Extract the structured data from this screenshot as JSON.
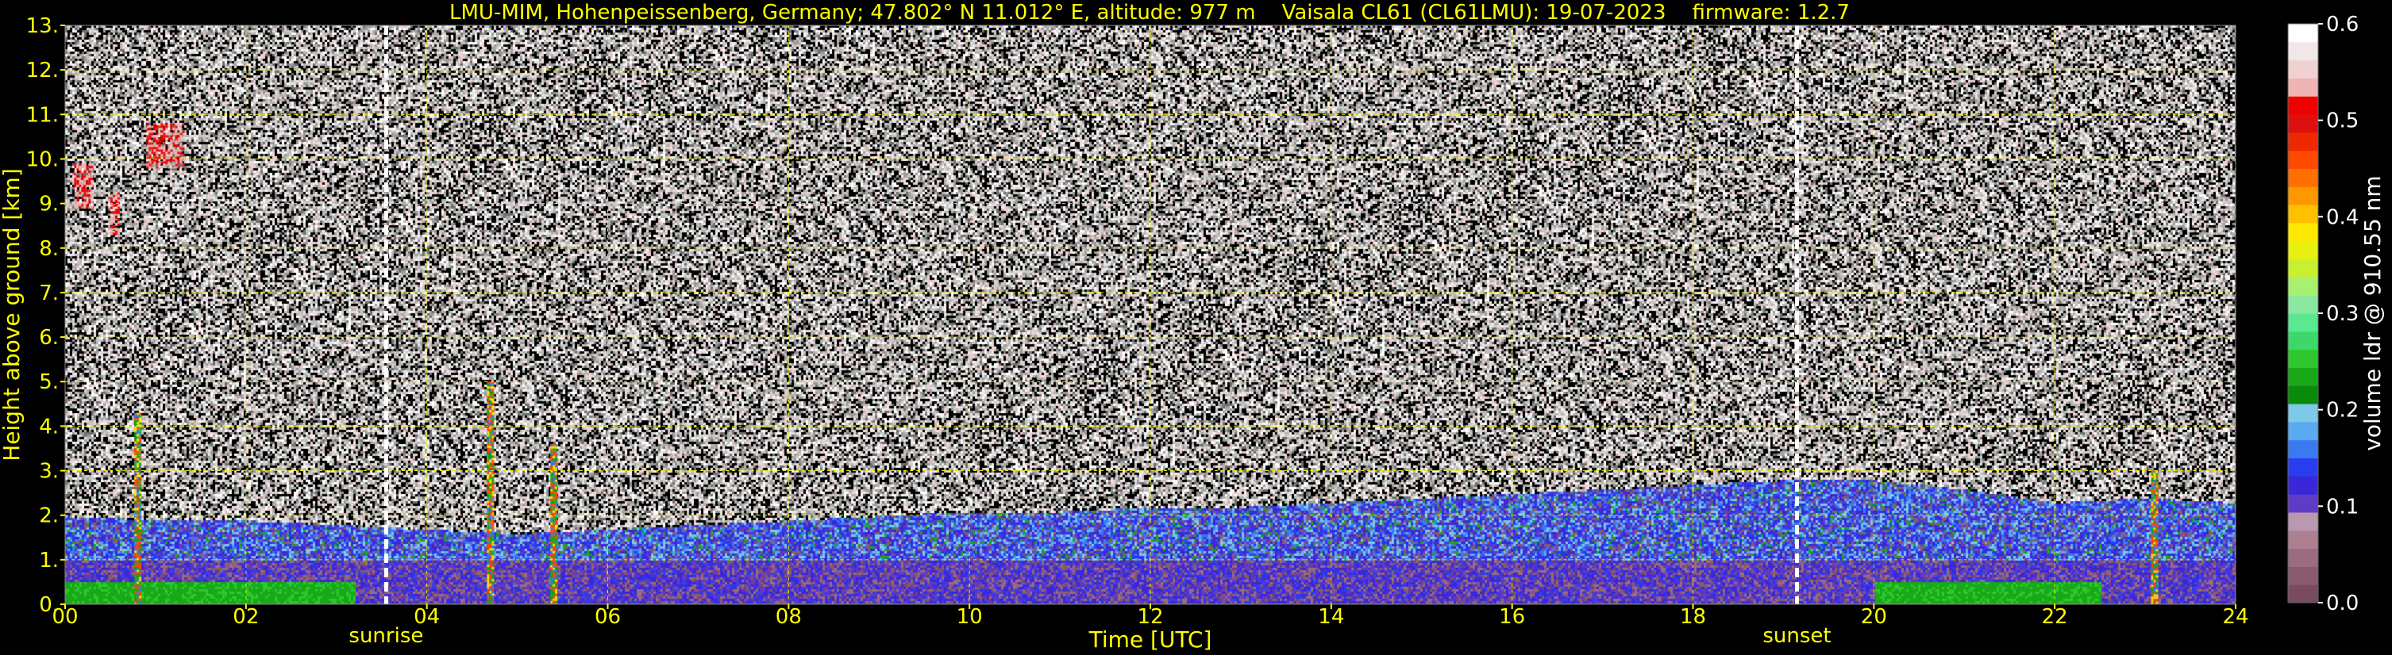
{
  "chart_data": {
    "type": "heatmap",
    "title": "LMU-MIM, Hohenpeissenberg, Germany; 47.802° N 11.012° E, altitude: 977 m    Vaisala CL61 (CL61LMU): 19-07-2023    firmware: 1.2.7",
    "xlabel": "Time [UTC]",
    "ylabel": "Height above ground [km]",
    "xlim": [
      0,
      24
    ],
    "ylim": [
      0,
      13
    ],
    "x_ticks": [
      0,
      2,
      4,
      6,
      8,
      10,
      12,
      14,
      16,
      18,
      20,
      22,
      24
    ],
    "x_tick_labels": [
      "00",
      "02",
      "04",
      "06",
      "08",
      "10",
      "12",
      "14",
      "16",
      "18",
      "20",
      "22",
      "24"
    ],
    "y_ticks": [
      0,
      1,
      2,
      3,
      4,
      5,
      6,
      7,
      8,
      9,
      10,
      11,
      12,
      13
    ],
    "y_tick_labels": [
      "0.",
      "1.",
      "2.",
      "3.",
      "4.",
      "5.",
      "6.",
      "7.",
      "8.",
      "9.",
      "10.",
      "11.",
      "12.",
      "13."
    ],
    "grid": true,
    "events": [
      {
        "label": "sunrise",
        "time": 3.55
      },
      {
        "label": "sunset",
        "time": 19.15
      }
    ],
    "colorbar": {
      "label": "volume ldr @ 910.55 nm",
      "range": [
        0.0,
        0.6
      ],
      "ticks": [
        0.0,
        0.1,
        0.2,
        0.3,
        0.4,
        0.5,
        0.6
      ],
      "tick_labels": [
        "0.0",
        "0.1",
        "0.2",
        "0.3",
        "0.4",
        "0.5",
        "0.6"
      ],
      "colors": [
        "#7a4a5e",
        "#8a5a6e",
        "#9b6c80",
        "#ac8090",
        "#b998b0",
        "#5e3cc8",
        "#3a28d8",
        "#2a3cf0",
        "#3a7af0",
        "#5aaaf0",
        "#7ec8e8",
        "#0a8a0a",
        "#18a818",
        "#2ec82e",
        "#3cd86c",
        "#5ae890",
        "#8ae8a0",
        "#a8f070",
        "#c8f030",
        "#e8f010",
        "#ffe800",
        "#ffc000",
        "#ff9800",
        "#ff7000",
        "#ff4800",
        "#ee2800",
        "#dd1010",
        "#f00000",
        "#f0b4b4",
        "#f0d0d0",
        "#f0e8e8",
        "#ffffff"
      ]
    },
    "features": {
      "boundary_layer_top_km": [
        2.0,
        1.9,
        1.9,
        1.8,
        1.7,
        1.6,
        1.7,
        1.8,
        1.9,
        2.0,
        2.1,
        2.1,
        2.2,
        2.2,
        2.3,
        2.4,
        2.5,
        2.6,
        2.7,
        2.8,
        2.8,
        2.6,
        2.3,
        2.4,
        2.3
      ],
      "near_ground_aerosol_layer_top_km": 1.0,
      "high_cloud_patches": [
        {
          "t0": 0.1,
          "t1": 0.3,
          "h0": 8.9,
          "h1": 9.9
        },
        {
          "t0": 0.5,
          "t1": 0.6,
          "h0": 8.3,
          "h1": 9.3
        },
        {
          "t0": 0.9,
          "t1": 1.3,
          "h0": 9.8,
          "h1": 10.8
        }
      ],
      "convective_plumes": [
        {
          "time": 0.8,
          "top_km": 4.3
        },
        {
          "time": 4.7,
          "top_km": 5.0
        },
        {
          "time": 5.4,
          "top_km": 3.6
        },
        {
          "time": 23.1,
          "top_km": 3.0
        }
      ]
    }
  }
}
